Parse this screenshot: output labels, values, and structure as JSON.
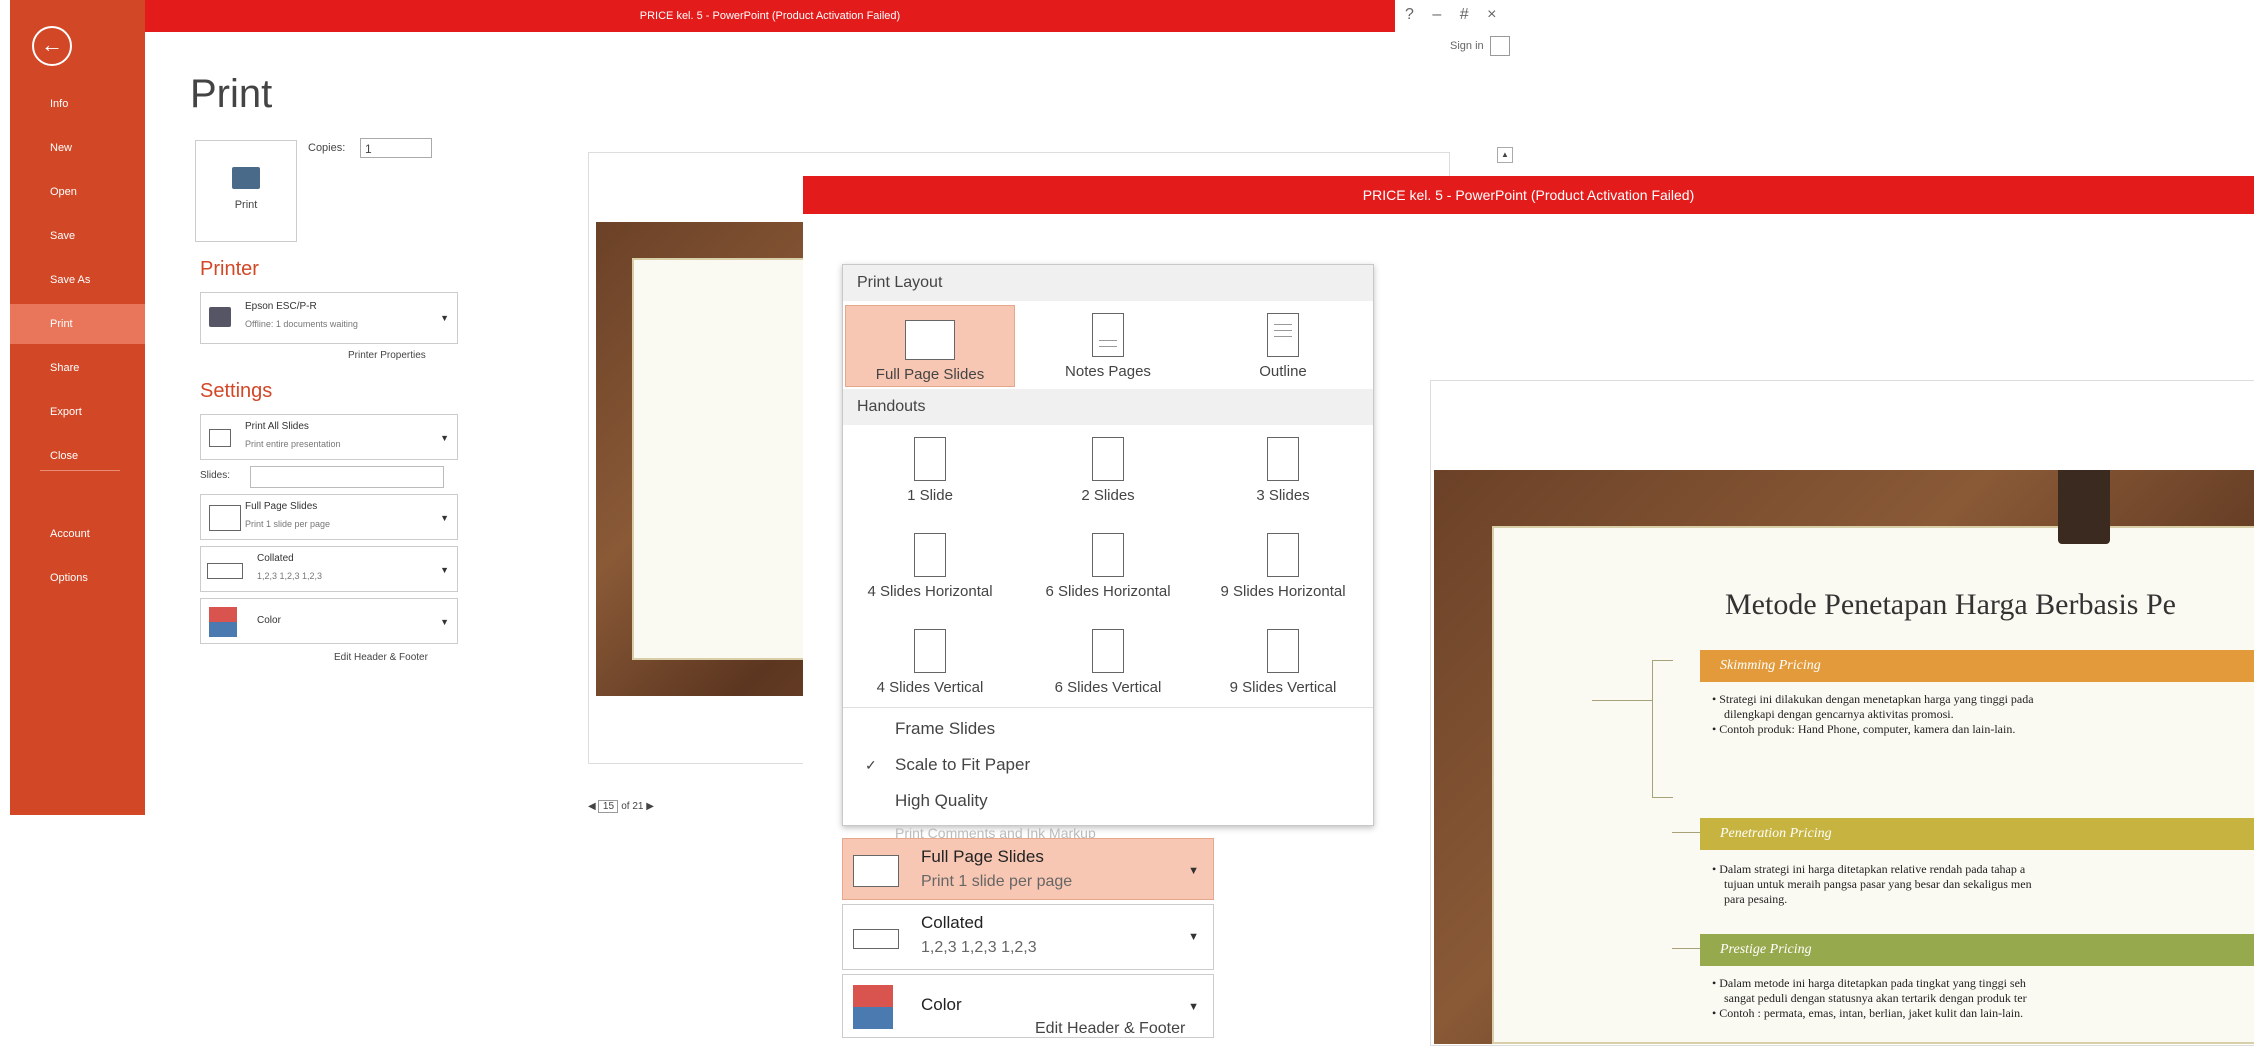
{
  "back_window": {
    "title": "PRICE kel. 5 - PowerPoint (Product Activation Failed)",
    "controls": [
      "?",
      "–",
      "#",
      "×"
    ],
    "signin": "Sign in",
    "sidebar": {
      "back_glyph": "←",
      "items": [
        "Info",
        "New",
        "Open",
        "Save",
        "Save As",
        "Print",
        "Share",
        "Export",
        "Close",
        "Account",
        "Options"
      ],
      "active": "Print"
    },
    "page_title": "Print",
    "print_button": "Print",
    "copies_label": "Copies:",
    "copies_value": "1",
    "printer_header": "Printer",
    "printer_name": "Epson ESC/P-R",
    "printer_status": "Offline: 1 documents waiting",
    "printer_properties": "Printer Properties",
    "settings_header": "Settings",
    "print_all_title": "Print All Slides",
    "print_all_sub": "Print entire presentation",
    "slides_label": "Slides:",
    "layout_title": "Full Page Slides",
    "layout_sub": "Print 1 slide per page",
    "collated_title": "Collated",
    "collated_sub": "1,2,3   1,2,3   1,2,3",
    "color_title": "Color",
    "edit_header_footer": "Edit Header & Footer",
    "pager_current": "15",
    "pager_total": "of 21"
  },
  "front_window": {
    "title": "PRICE kel. 5 -  PowerPoint (Product Activation Failed)",
    "panel": {
      "print_layout_header": "Print Layout",
      "layouts": [
        "Full Page Slides",
        "Notes Pages",
        "Outline"
      ],
      "handouts_header": "Handouts",
      "handouts_row1": [
        "1 Slide",
        "2 Slides",
        "3 Slides"
      ],
      "handouts_row2": [
        "4 Slides Horizontal",
        "6 Slides Horizontal",
        "9 Slides Horizontal"
      ],
      "handouts_row3": [
        "4 Slides Vertical",
        "6 Slides Vertical",
        "9 Slides Vertical"
      ],
      "frame_slides": "Frame Slides",
      "scale_to_fit": "Scale to Fit Paper",
      "high_quality": "High Quality",
      "print_comments": "Print Comments and Ink Markup",
      "check_glyph": "✓"
    },
    "layout_dropdown": {
      "title": "Full Page Slides",
      "sub": "Print 1 slide per page"
    },
    "collated_dropdown": {
      "title": "Collated",
      "sub": "1,2,3   1,2,3   1,2,3"
    },
    "color_dropdown": {
      "title": "Color"
    },
    "edit_header_footer": "Edit Header & Footer"
  },
  "slide": {
    "heading": "Metode Penetapan Harga Berbasis Pe",
    "sections": [
      {
        "label": "Skimming Pricing",
        "color": "#e29a3b",
        "bullets": [
          "Strategi ini dilakukan dengan menetapkan harga yang tinggi pada",
          "dilengkapi dengan gencarnya aktivitas promosi.",
          "Contoh produk: Hand Phone, computer, kamera dan lain-lain."
        ]
      },
      {
        "label": "Penetration Pricing",
        "color": "#c7b33f",
        "bullets": [
          "Dalam strategi ini harga ditetapkan relative rendah pada tahap a",
          "tujuan untuk meraih pangsa pasar yang besar dan sekaligus men",
          "para pesaing."
        ]
      },
      {
        "label": "Prestige Pricing",
        "color": "#96a94c",
        "bullets": [
          "Dalam metode ini harga ditetapkan pada tingkat yang tinggi seh",
          "sangat peduli dengan statusnya akan tertarik dengan produk ter",
          "Contoh : permata, emas, intan, berlian, jaket kulit dan lain-lain."
        ]
      }
    ]
  }
}
